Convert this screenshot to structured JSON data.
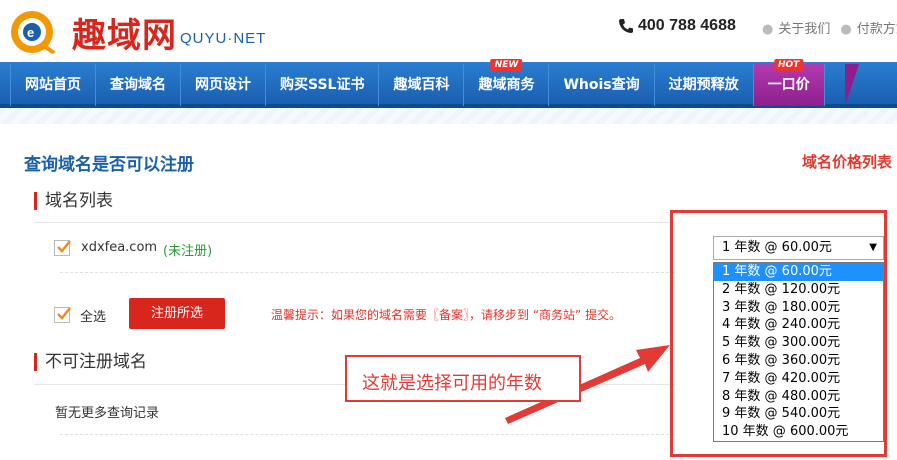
{
  "header": {
    "logo_cn": "趣域网",
    "logo_en": "QUYU·NET",
    "phone": "400 788 4688",
    "links": [
      "关于我们",
      "付款方式"
    ]
  },
  "nav": {
    "items": [
      {
        "label": "网站首页"
      },
      {
        "label": "查询域名"
      },
      {
        "label": "网页设计"
      },
      {
        "label": "购买SSL证书"
      },
      {
        "label": "趣域百科"
      },
      {
        "label": "趣域商务",
        "badge": "NEW"
      },
      {
        "label": "Whois查询"
      },
      {
        "label": "过期预释放"
      },
      {
        "label": "一口价",
        "badge": "HOT",
        "active": true
      }
    ]
  },
  "page": {
    "title": "查询域名是否可以注册",
    "price_link": "域名价格列表"
  },
  "domain_list": {
    "section_title": "域名列表",
    "rows": [
      {
        "domain": "xdxfea.com",
        "status": "(未注册)",
        "checked": true
      }
    ],
    "select_all_label": "全选",
    "register_button": "注册所选",
    "tip": "温馨提示：如果您的域名需要〖备案〗，请移步到 “商务站” 提交。"
  },
  "year_select": {
    "selected": "1 年数 @ 60.00元",
    "options": [
      "1 年数 @ 60.00元",
      "2 年数 @ 120.00元",
      "3 年数 @ 180.00元",
      "4 年数 @ 240.00元",
      "5 年数 @ 300.00元",
      "6 年数 @ 360.00元",
      "7 年数 @ 420.00元",
      "8 年数 @ 480.00元",
      "9 年数 @ 540.00元",
      "10 年数 @ 600.00元"
    ],
    "highlighted_index": 0
  },
  "unavailable": {
    "section_title": "不可注册域名",
    "empty_text": "暂无更多查询记录"
  },
  "annotation": {
    "text": "这就是选择可用的年数",
    "color": "#e33a36"
  },
  "colors": {
    "brand_red": "#d9261c",
    "nav_blue": "#1a5fb0",
    "nav_active": "#8d1f8c",
    "link_blue": "#1a5faa",
    "status_green": "#2b9a3a"
  }
}
